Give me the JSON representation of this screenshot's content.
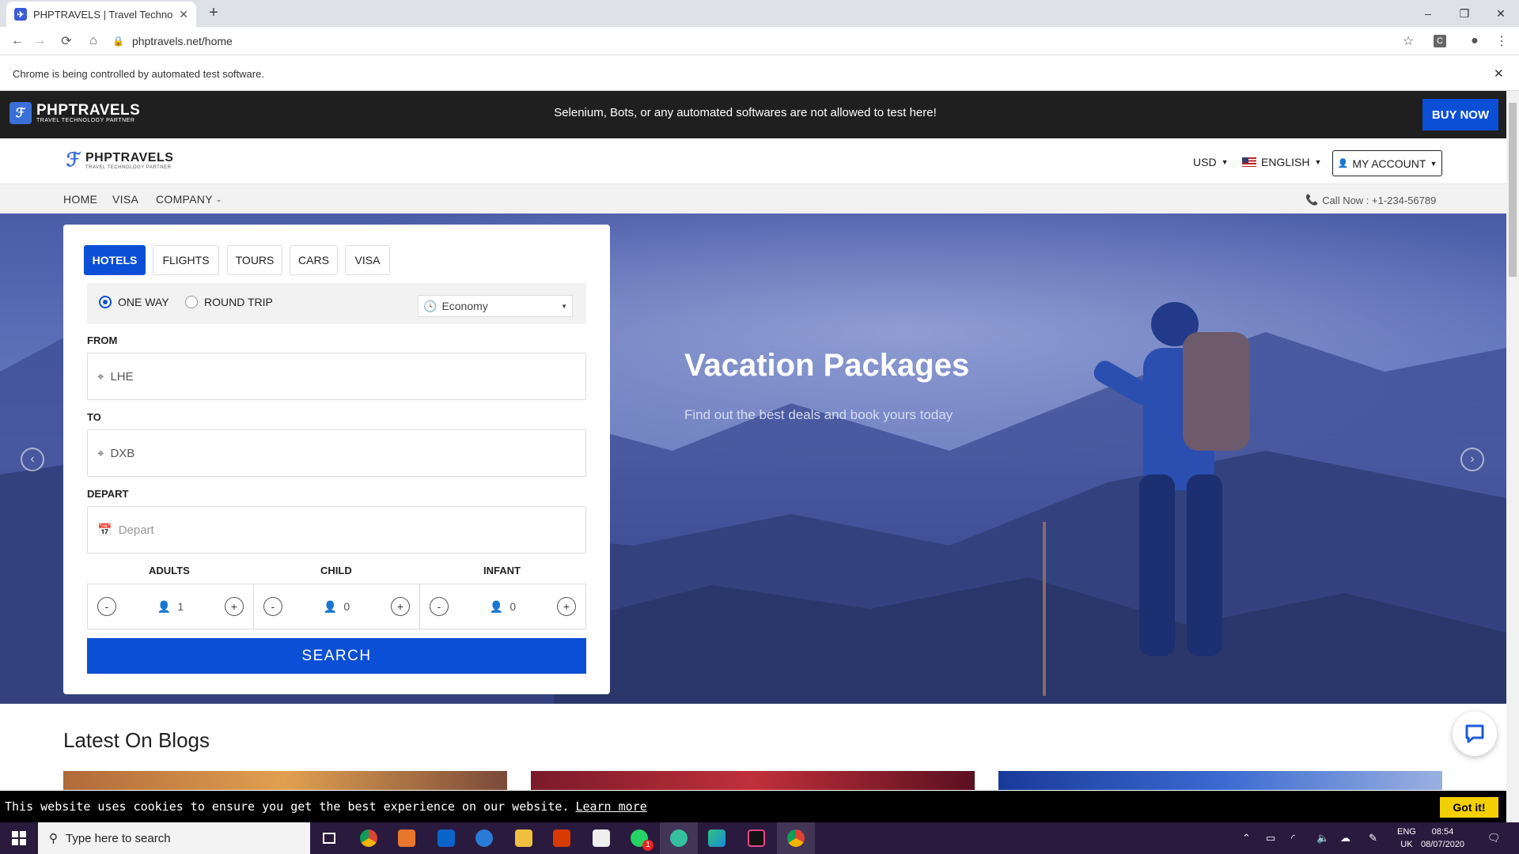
{
  "browser": {
    "tab_title": "PHPTRAVELS | Travel Technology",
    "url": "phptravels.net/home",
    "automation_notice": "Chrome is being controlled by automated test software."
  },
  "site": {
    "brand": "PHPTRAVELS",
    "brand_tagline": "TRAVEL TECHNOLOGY PARTNER",
    "top_warning": "Selenium, Bots, or any automated softwares are not allowed to test here!",
    "buy_now": "BUY NOW",
    "currency": "USD",
    "language": "ENGLISH",
    "account": "MY ACCOUNT",
    "nav": [
      "HOME",
      "VISA",
      "COMPANY"
    ],
    "call": "Call Now : +1-234-56789"
  },
  "search": {
    "tabs": [
      "HOTELS",
      "FLIGHTS",
      "TOURS",
      "CARS",
      "VISA"
    ],
    "active_tab": "HOTELS",
    "trip_one_way": "ONE WAY",
    "trip_round": "ROUND TRIP",
    "cabin": "Economy",
    "from_label": "FROM",
    "from_value": "LHE",
    "to_label": "TO",
    "to_value": "DXB",
    "depart_label": "DEPART",
    "depart_placeholder": "Depart",
    "adults_label": "ADULTS",
    "adults_value": "1",
    "child_label": "CHILD",
    "child_value": "0",
    "infant_label": "INFANT",
    "infant_value": "0",
    "minus": "-",
    "plus": "+",
    "search_button": "SEARCH"
  },
  "hero": {
    "title": "Vacation Packages",
    "subtitle": "Find out the best deals and book yours today"
  },
  "blogs": {
    "title": "Latest On Blogs"
  },
  "cookie": {
    "text": "This website uses cookies to ensure you get the best experience on our website.",
    "link": "Learn more",
    "button": "Got it!"
  },
  "taskbar": {
    "search_placeholder": "Type here to search",
    "lang": "ENG",
    "region": "UK",
    "time": "08:54",
    "date": "08/07/2020",
    "notification_count": "1"
  },
  "colors": {
    "primary": "#0b4fd6",
    "topbar": "#1f1f1f",
    "cookie_button": "#f5d000",
    "taskbar": "#2a1a3e"
  }
}
